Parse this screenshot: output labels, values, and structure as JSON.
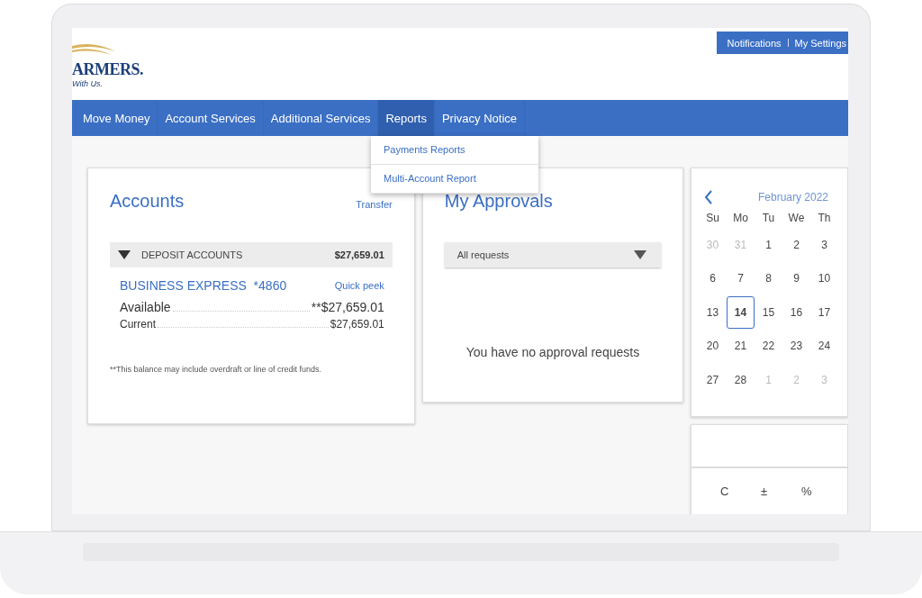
{
  "header": {
    "logo_text": "ARMERS.",
    "tagline": "With Us.",
    "links": [
      "Notifications",
      "My Settings"
    ]
  },
  "nav": [
    {
      "label": "Move Money",
      "selected": false
    },
    {
      "label": "Account Services",
      "selected": false
    },
    {
      "label": "Additional Services",
      "selected": false
    },
    {
      "label": "Reports",
      "selected": true
    },
    {
      "label": "Privacy Notice",
      "selected": false
    }
  ],
  "dropdown": [
    "Payments Reports",
    "Multi-Account Report"
  ],
  "accounts": {
    "title": "Accounts",
    "action": "Transfer",
    "group": {
      "label": "DEPOSIT ACCOUNTS",
      "total": "$27,659.01",
      "expanded": true
    },
    "account": {
      "name": "BUSINESS EXPRESS",
      "number": "*4860",
      "link": "Quick peek",
      "balances": [
        {
          "label": "Available",
          "value": "**$27,659.01"
        },
        {
          "label": "Current",
          "value": "$27,659.01"
        }
      ]
    },
    "note": "**This balance may include overdraft or line of credit funds."
  },
  "approvals": {
    "title": "My Approvals",
    "filter": "All requests",
    "empty_message": "You have no approval requests"
  },
  "calendar": {
    "month": "February 2022",
    "weekdays": [
      "Su",
      "Mo",
      "Tu",
      "We",
      "Th"
    ],
    "weeks": [
      [
        {
          "day": "30",
          "outside": true,
          "selected": false
        },
        {
          "day": "31",
          "outside": true,
          "selected": false
        },
        {
          "day": "1",
          "outside": false,
          "selected": false
        },
        {
          "day": "2",
          "outside": false,
          "selected": false
        },
        {
          "day": "3",
          "outside": false,
          "selected": false
        }
      ],
      [
        {
          "day": "6",
          "outside": false,
          "selected": false
        },
        {
          "day": "7",
          "outside": false,
          "selected": false
        },
        {
          "day": "8",
          "outside": false,
          "selected": false
        },
        {
          "day": "9",
          "outside": false,
          "selected": false
        },
        {
          "day": "10",
          "outside": false,
          "selected": false
        }
      ],
      [
        {
          "day": "13",
          "outside": false,
          "selected": false
        },
        {
          "day": "14",
          "outside": false,
          "selected": true
        },
        {
          "day": "15",
          "outside": false,
          "selected": false
        },
        {
          "day": "16",
          "outside": false,
          "selected": false
        },
        {
          "day": "17",
          "outside": false,
          "selected": false
        }
      ],
      [
        {
          "day": "20",
          "outside": false,
          "selected": false
        },
        {
          "day": "21",
          "outside": false,
          "selected": false
        },
        {
          "day": "22",
          "outside": false,
          "selected": false
        },
        {
          "day": "23",
          "outside": false,
          "selected": false
        },
        {
          "day": "24",
          "outside": false,
          "selected": false
        }
      ],
      [
        {
          "day": "27",
          "outside": false,
          "selected": false
        },
        {
          "day": "28",
          "outside": false,
          "selected": false
        },
        {
          "day": "1",
          "outside": true,
          "selected": false
        },
        {
          "day": "2",
          "outside": true,
          "selected": false
        },
        {
          "day": "3",
          "outside": true,
          "selected": false
        }
      ]
    ]
  },
  "calculator": {
    "keys": [
      "C",
      "±",
      "%"
    ]
  }
}
